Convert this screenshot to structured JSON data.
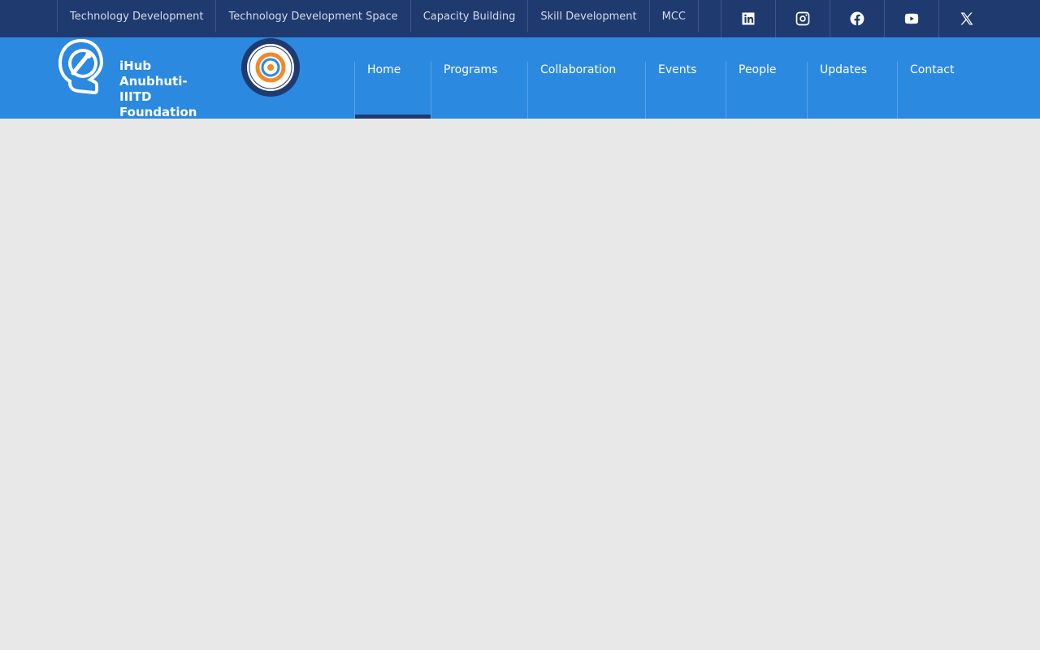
{
  "topnav": {
    "items": [
      "Technology Development",
      "Technology Development Space",
      "Capacity Building",
      "Skill Development",
      "MCC"
    ]
  },
  "social": {
    "icons": [
      "linkedin-icon",
      "instagram-icon",
      "facebook-icon",
      "youtube-icon",
      "x-icon"
    ]
  },
  "brand": {
    "logo_text_line1": "iHub Anubhuti-",
    "logo_text_line2": "IIITD Foundation"
  },
  "mainnav": {
    "items": [
      "Home",
      "Programs",
      "Collaboration",
      "Events",
      "People",
      "Updates",
      "Contact"
    ],
    "active": "Home"
  },
  "colors": {
    "topbar": "#1f3a6e",
    "header": "#2b89df",
    "page_background": "#e8e8e8",
    "active_indicator": "#1f3a6e"
  }
}
